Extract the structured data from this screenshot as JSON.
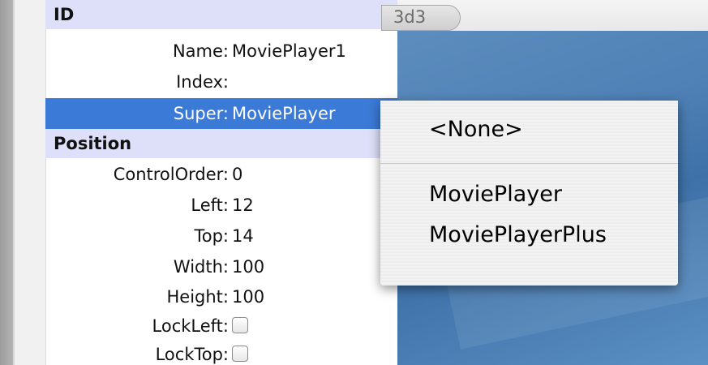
{
  "top_tab": {
    "label": "3d3"
  },
  "sections": {
    "id": "ID",
    "position": "Position"
  },
  "properties": {
    "name": {
      "label": "Name:",
      "value": "MoviePlayer1"
    },
    "index": {
      "label": "Index:",
      "value": ""
    },
    "super": {
      "label": "Super:",
      "value": "MoviePlayer"
    },
    "control_order": {
      "label": "ControlOrder:",
      "value": "0"
    },
    "left": {
      "label": "Left:",
      "value": "12"
    },
    "top": {
      "label": "Top:",
      "value": "14"
    },
    "width": {
      "label": "Width:",
      "value": "100"
    },
    "height": {
      "label": "Height:",
      "value": "100"
    },
    "lock_left": {
      "label": "LockLeft:",
      "checked": false
    },
    "lock_top": {
      "label": "LockTop:",
      "checked": false
    }
  },
  "super_menu": {
    "items": [
      "<None>",
      "MoviePlayer",
      "MoviePlayerPlus"
    ]
  },
  "colors": {
    "selection": "#3b7ad6",
    "section_header": "#dde0f8",
    "desktop": "#4f81b6"
  }
}
